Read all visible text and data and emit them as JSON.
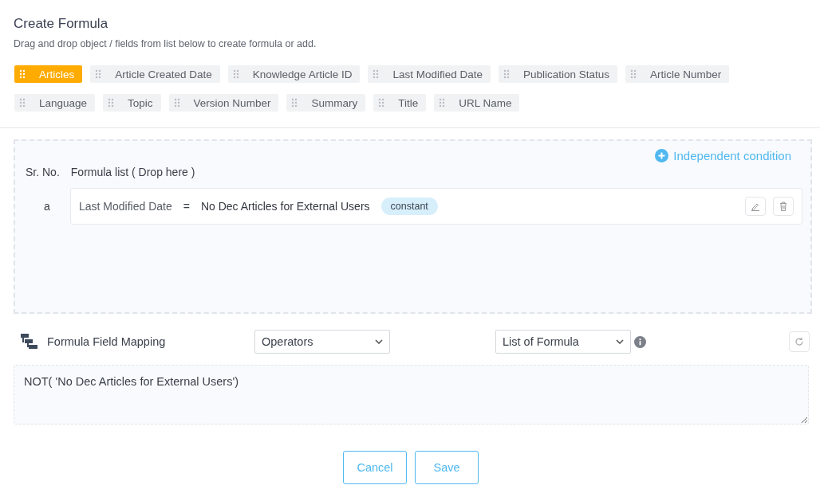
{
  "header": {
    "title": "Create Formula",
    "subtitle": "Drag and drop object / fields from list below to create formula or add."
  },
  "fields": [
    {
      "label": "Articles",
      "selected": true
    },
    {
      "label": "Article Created Date",
      "selected": false
    },
    {
      "label": "Knowledge Article ID",
      "selected": false
    },
    {
      "label": "Last Modified Date",
      "selected": false
    },
    {
      "label": "Publication Status",
      "selected": false
    },
    {
      "label": "Article Number",
      "selected": false
    },
    {
      "label": "Language",
      "selected": false
    },
    {
      "label": "Topic",
      "selected": false
    },
    {
      "label": "Version Number",
      "selected": false
    },
    {
      "label": "Summary",
      "selected": false
    },
    {
      "label": "Title",
      "selected": false
    },
    {
      "label": "URL Name",
      "selected": false
    }
  ],
  "formula_area": {
    "add_link": "Independent condition",
    "columns": [
      "Sr. No.",
      "Formula list ( Drop here )"
    ],
    "rows": [
      {
        "index": "a",
        "field": "Last Modified Date",
        "operator": "=",
        "value": "No Dec Articles for External Users",
        "tag": "constant"
      }
    ]
  },
  "mapping": {
    "label": "Formula Field Mapping",
    "operators": "Operators",
    "formulas": "List of Formula"
  },
  "expression": "NOT( 'No Dec Articles for External Users')",
  "buttons": [
    "Cancel",
    "Save"
  ]
}
